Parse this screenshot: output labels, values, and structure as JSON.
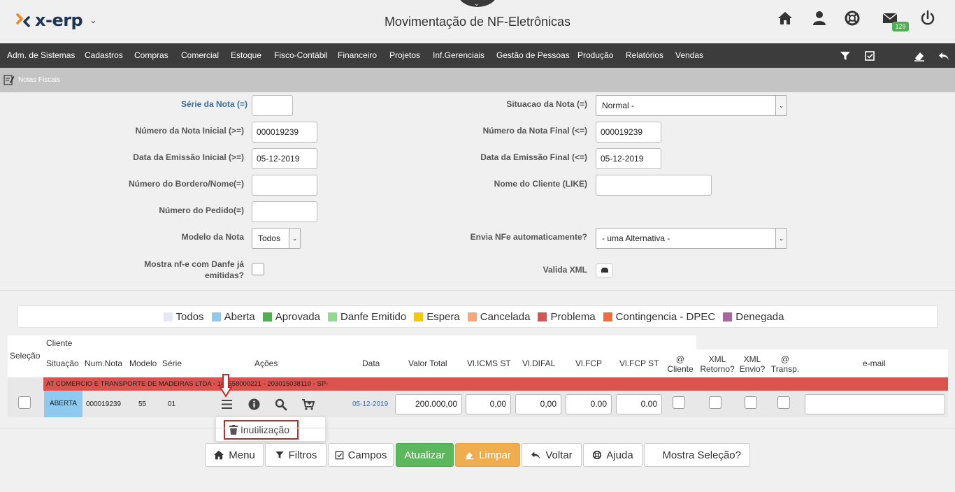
{
  "header": {
    "brand": "x-erp",
    "title": "Movimentação de NF-Eletrônicas",
    "mail_count": "129",
    "colors": {
      "brand": "#1f3552",
      "accent_orange": "#f5821f",
      "badge": "#4caf50"
    }
  },
  "menu": {
    "items": [
      "Adm. de Sistemas",
      "Cadastros",
      "Compras",
      "Comercial",
      "Estoque",
      "Fisco-Contábil",
      "Financeiro",
      "Projetos",
      "Inf.Gerenciais",
      "Gestão de Pessoas",
      "Produção",
      "Relatórios",
      "Vendas"
    ]
  },
  "breadcrumb": {
    "label": "Notas Fiscais"
  },
  "form": {
    "serie_label": "Série da Nota (=)",
    "serie_value": "",
    "situacao_label": "Situacao da Nota (=)",
    "situacao_value": "Normal -",
    "num_inicial_label": "Número da Nota Inicial (>=)",
    "num_inicial_value": "000019239",
    "num_final_label": "Número da Nota Final (<=)",
    "num_final_value": "000019239",
    "data_inicial_label": "Data da Emissão Inicial (>=)",
    "data_inicial_value": "05-12-2019",
    "data_final_label": "Data da Emissão Final (<=)",
    "data_final_value": "05-12-2019",
    "bordero_label": "Número do Bordero/Nome(=)",
    "bordero_value": "",
    "cliente_label": "Nome do Cliente (LIKE)",
    "cliente_value": "",
    "pedido_label": "Número do Pedido(=)",
    "pedido_value": "",
    "modelo_label": "Modelo da Nota",
    "modelo_value": "Todos",
    "envia_label": "Envia NFe automaticamente?",
    "envia_value": "- uma Alternativa -",
    "danfe_label_1": "Mostra nf-e com Danfe já",
    "danfe_label_2": "emitidas?",
    "valida_label": "Valida XML"
  },
  "legend": [
    {
      "label": "Todos",
      "color": "#e8e8f4"
    },
    {
      "label": "Aberta",
      "color": "#8ec9f0"
    },
    {
      "label": "Aprovada",
      "color": "#4caf50"
    },
    {
      "label": "Danfe Emitido",
      "color": "#90dc8c"
    },
    {
      "label": "Espera",
      "color": "#f2c811"
    },
    {
      "label": "Cancelada",
      "color": "#f8a878"
    },
    {
      "label": "Problema",
      "color": "#d9534f"
    },
    {
      "label": "Contingencia - DPEC",
      "color": "#f26b3a"
    },
    {
      "label": "Denegada",
      "color": "#a8679a"
    }
  ],
  "table": {
    "headers": {
      "selecao": "Seleção",
      "cliente": "Cliente",
      "situacao": "Situação",
      "num_nota": "Num.Nota",
      "modelo": "Modelo",
      "serie": "Série",
      "acoes": "Ações",
      "data": "Data",
      "valor_total": "Valor Total",
      "vl_icms_st": "Vl.ICMS ST",
      "vl_difal": "Vl.DIFAL",
      "vl_fcp": "Vl.FCP",
      "vl_fcp_st": "Vl.FCP ST",
      "at_cliente_1": "@",
      "at_cliente_2": "Cliente",
      "xml_retorno_1": "XML",
      "xml_retorno_2": "Retorno?",
      "xml_envio_1": "XML",
      "xml_envio_2": "Envio?",
      "at_transp_1": "@",
      "at_transp_2": "Transp.",
      "email": "e-mail"
    },
    "row": {
      "cliente": "AT COMERCIO E TRANSPORTE DE MADEIRAS LTDA - 14.  558000221 - 203015038110 - SP-",
      "situacao": "ABERTA",
      "num_nota": "000019239",
      "modelo": "55",
      "serie": "01",
      "data": "05-12-2019",
      "valor_total": "200.000,00",
      "vl_icms_st": "0,00",
      "vl_difal": "0,00",
      "vl_fcp": "0.00",
      "vl_fcp_st": "0.00",
      "email": ""
    }
  },
  "popup": {
    "inutilizacao": "Inutilização"
  },
  "buttons": {
    "menu": "Menu",
    "filtros": "Filtros",
    "campos": "Campos",
    "atualizar": "Atualizar",
    "limpar": "Limpar",
    "voltar": "Voltar",
    "ajuda": "Ajuda",
    "mostra_selecao": "Mostra Seleção?"
  }
}
